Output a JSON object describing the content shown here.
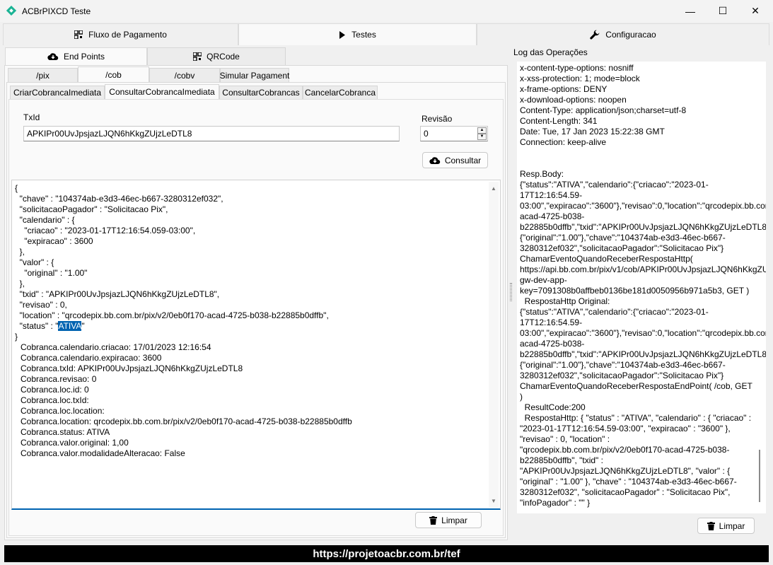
{
  "window": {
    "title": "ACBrPIXCD Teste",
    "accent": "#1ab394",
    "minimize": "—",
    "maximize": "☐",
    "close": "✕"
  },
  "main_tabs": [
    {
      "label": "Fluxo de Pagamento",
      "icon": "qrcode-icon"
    },
    {
      "label": "Testes",
      "icon": "play-icon"
    },
    {
      "label": "Configuracao",
      "icon": "wrench-icon"
    }
  ],
  "sub_tabs": [
    {
      "label": "End Points",
      "icon": "cloud-download-icon"
    },
    {
      "label": "QRCode",
      "icon": "qrcode-icon"
    }
  ],
  "endpoint_tabs": [
    "/pix",
    "/cob",
    "/cobv",
    "Simular Pagament"
  ],
  "cob_tabs": [
    "CriarCobrancaImediata",
    "ConsultarCobrancaImediata",
    "ConsultarCobrancas",
    "CancelarCobranca"
  ],
  "form": {
    "txid_label": "TxId",
    "txid_value": "APKIPr00UvJpsjazLJQN6hKkgZUjzLeDTL8",
    "revisao_label": "Revisão",
    "revisao_value": "0",
    "consultar_label": "Consultar"
  },
  "result": {
    "json_before": "{\n  \"chave\" : \"104374ab-e3d3-46ec-b667-3280312ef032\",\n  \"solicitacaoPagador\" : \"Solicitacao Pix\",\n  \"calendario\" : {\n    \"criacao\" : \"2023-01-17T12:16:54.059-03:00\",\n    \"expiracao\" : 3600\n  },\n  \"valor\" : {\n    \"original\" : \"1.00\"\n  },\n  \"txid\" : \"APKIPr00UvJpsjazLJQN6hKkgZUjzLeDTL8\",\n  \"revisao\" : 0,\n  \"location\" : \"qrcodepix.bb.com.br/pix/v2/0eb0f170-acad-4725-b038-b22885b0dffb\",\n  \"status\" : \"",
    "json_selected": "ATIVA",
    "json_after": "\"\n}",
    "lines": [
      "Cobranca.calendario.criacao: 17/01/2023 12:16:54",
      "Cobranca.calendario.expiracao: 3600",
      "Cobranca.txId: APKIPr00UvJpsjazLJQN6hKkgZUjzLeDTL8",
      "Cobranca.revisao: 0",
      "Cobranca.loc.id: 0",
      "Cobranca.loc.txId:",
      "Cobranca.loc.location:",
      "Cobranca.location: qrcodepix.bb.com.br/pix/v2/0eb0f170-acad-4725-b038-b22885b0dffb",
      "Cobranca.status: ATIVA",
      "Cobranca.valor.original: 1,00",
      "Cobranca.valor.modalidadeAlteracao: False"
    ],
    "limpar_label": "Limpar"
  },
  "log": {
    "title": "Log das Operações",
    "text": "x-content-type-options: nosniff\nx-xss-protection: 1; mode=block\nx-frame-options: DENY\nx-download-options: noopen\nContent-Type: application/json;charset=utf-8\nContent-Length: 341\nDate: Tue, 17 Jan 2023 15:22:38 GMT\nConnection: keep-alive\n\n\nResp.Body:\n{\"status\":\"ATIVA\",\"calendario\":{\"criacao\":\"2023-01-17T12:16:54.59-03:00\",\"expiracao\":\"3600\"},\"revisao\":0,\"location\":\"qrcodepix.bb.com.br/pix/v2/0eb0f170-acad-4725-b038-b22885b0dffb\",\"txid\":\"APKIPr00UvJpsjazLJQN6hKkgZUjzLeDTL8\",\"valor\":{\"original\":\"1.00\"},\"chave\":\"104374ab-e3d3-46ec-b667-3280312ef032\",\"solicitacaoPagador\":\"Solicitacao Pix\"}\nChamarEventoQuandoReceberRespostaHttp( https://api.bb.com.br/pix/v1/cob/APKIPr00UvJpsjazLJQN6hKkgZUjzLeDTL8?gw-dev-app-key=7091308b0affbeb0136be181d0050956b971a5b3, GET )\n  RespostaHttp Original:\n{\"status\":\"ATIVA\",\"calendario\":{\"criacao\":\"2023-01-17T12:16:54.59-03:00\",\"expiracao\":\"3600\"},\"revisao\":0,\"location\":\"qrcodepix.bb.com.br/pix/v2/0eb0f170-acad-4725-b038-b22885b0dffb\",\"txid\":\"APKIPr00UvJpsjazLJQN6hKkgZUjzLeDTL8\",\"valor\":{\"original\":\"1.00\"},\"chave\":\"104374ab-e3d3-46ec-b667-3280312ef032\",\"solicitacaoPagador\":\"Solicitacao Pix\"}\nChamarEventoQuandoReceberRespostaEndPoint( /cob, GET )\n  ResultCode:200\n  RespostaHttp: { \"status\" : \"ATIVA\", \"calendario\" : { \"criacao\" : \"2023-01-17T12:16:54.59-03:00\", \"expiracao\" : \"3600\" }, \"revisao\" : 0, \"location\" : \"qrcodepix.bb.com.br/pix/v2/0eb0f170-acad-4725-b038-b22885b0dffb\", \"txid\" : \"APKIPr00UvJpsjazLJQN6hKkgZUjzLeDTL8\", \"valor\" : { \"original\" : \"1.00\" }, \"chave\" : \"104374ab-e3d3-46ec-b667-3280312ef032\", \"solicitacaoPagador\" : \"Solicitacao Pix\", \"infoPagador\" : \"\" }",
    "limpar_label": "Limpar"
  },
  "footer": {
    "text": "https://projetoacbr.com.br/tef"
  }
}
